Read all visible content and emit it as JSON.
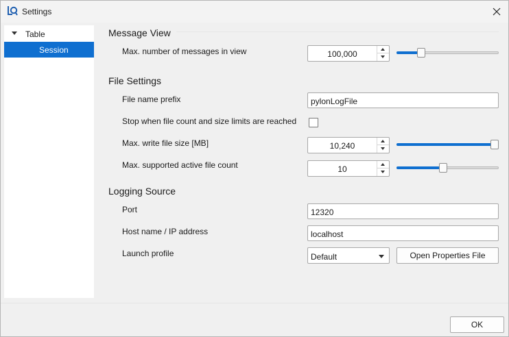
{
  "window": {
    "title": "Settings",
    "app_icon": "log-viewer-icon",
    "close_icon": "close-icon"
  },
  "sidebar": {
    "items": [
      {
        "label": "Table",
        "expanded": true,
        "selected": false
      },
      {
        "label": "Session",
        "selected": true
      }
    ]
  },
  "sections": {
    "message_view": {
      "title": "Message View",
      "max_messages": {
        "label": "Max. number of messages in view",
        "value": "100,000",
        "slider_fraction": 0.22
      }
    },
    "file_settings": {
      "title": "File Settings",
      "file_name_prefix": {
        "label": "File name prefix",
        "value": "pylonLogFile"
      },
      "stop_when_limits": {
        "label": "Stop when file count and size limits are reached",
        "checked": false
      },
      "max_write_file_size": {
        "label": "Max. write file size [MB]",
        "value": "10,240",
        "slider_fraction": 1.0
      },
      "max_active_file_count": {
        "label": "Max. supported active file count",
        "value": "10",
        "slider_fraction": 0.45
      }
    },
    "logging_source": {
      "title": "Logging Source",
      "port": {
        "label": "Port",
        "value": "12320"
      },
      "host": {
        "label": "Host name / IP address",
        "value": "localhost"
      },
      "launch_profile": {
        "label": "Launch profile",
        "value": "Default"
      },
      "open_properties_button": "Open Properties File"
    }
  },
  "footer": {
    "ok_label": "OK"
  },
  "colors": {
    "accent": "#0f6fd0",
    "selection_text": "#ffffff",
    "window_bg": "#f0f0f0"
  }
}
